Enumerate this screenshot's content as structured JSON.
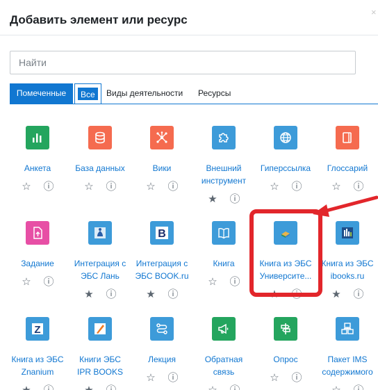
{
  "modal": {
    "title": "Добавить элемент или ресурс",
    "search_placeholder": "Найти"
  },
  "tabs": [
    {
      "label": "Помеченные"
    },
    {
      "label": "Все"
    },
    {
      "label": "Виды деятельности"
    },
    {
      "label": "Ресурсы"
    }
  ],
  "items": [
    {
      "line1": "Анкета",
      "line2": "",
      "color": "#24a55e",
      "icon": "bar-chart-icon",
      "starred": false
    },
    {
      "line1": "База данных",
      "line2": "",
      "color": "#f56b4f",
      "icon": "database-icon",
      "starred": false
    },
    {
      "line1": "Вики",
      "line2": "",
      "color": "#f56b4f",
      "icon": "network-icon",
      "starred": false
    },
    {
      "line1": "Внешний",
      "line2": "инструмент",
      "color": "#3d9bd9",
      "icon": "puzzle-icon",
      "starred": true
    },
    {
      "line1": "Гиперссылка",
      "line2": "",
      "color": "#3d9bd9",
      "icon": "globe-icon",
      "starred": false
    },
    {
      "line1": "Глоссарий",
      "line2": "",
      "color": "#f56b4f",
      "icon": "book-icon",
      "starred": false
    },
    {
      "line1": "Задание",
      "line2": "",
      "color": "#e74fa5",
      "icon": "file-upload-icon",
      "starred": false
    },
    {
      "line1": "Интеграция с",
      "line2": "ЭБС Лань",
      "color": "#3d9bd9",
      "icon": "lan-logo-icon",
      "starred": true
    },
    {
      "line1": "Интеграция с",
      "line2": "ЭБС BOOK.ru",
      "color": "#3d9bd9",
      "icon": "bookru-logo-icon",
      "starred": true
    },
    {
      "line1": "Книга",
      "line2": "",
      "color": "#3d9bd9",
      "icon": "open-book-icon",
      "starred": false
    },
    {
      "line1": "Книга из ЭБС",
      "line2": "Университе...",
      "color": "#3d9bd9",
      "icon": "university-book-icon",
      "starred": true
    },
    {
      "line1": "Книга из ЭБС",
      "line2": "ibooks.ru",
      "color": "#3d9bd9",
      "icon": "ibooks-logo-icon",
      "starred": true
    },
    {
      "line1": "Книга из ЭБС",
      "line2": "Znanium",
      "color": "#3d9bd9",
      "icon": "znanium-logo-icon",
      "starred": true
    },
    {
      "line1": "Книги ЭБС",
      "line2": "IPR BOOKS",
      "color": "#3d9bd9",
      "icon": "ipr-logo-icon",
      "starred": true
    },
    {
      "line1": "Лекция",
      "line2": "",
      "color": "#3d9bd9",
      "icon": "flow-icon",
      "starred": false
    },
    {
      "line1": "Обратная",
      "line2": "связь",
      "color": "#24a55e",
      "icon": "megaphone-icon",
      "starred": false
    },
    {
      "line1": "Опрос",
      "line2": "",
      "color": "#24a55e",
      "icon": "signpost-icon",
      "starred": false
    },
    {
      "line1": "Пакет IMS",
      "line2": "содержимого",
      "color": "#3d9bd9",
      "icon": "package-icon",
      "starred": false
    }
  ]
}
